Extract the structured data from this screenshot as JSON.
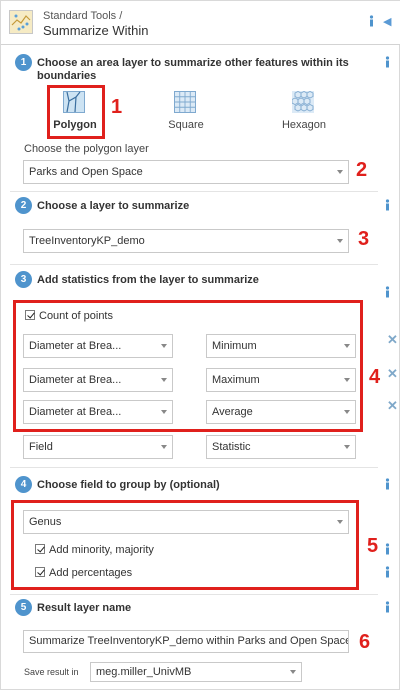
{
  "header": {
    "subtitle": "Standard Tools /",
    "title": "Summarize Within",
    "collapse_icon": "chevron-left-icon"
  },
  "step1": {
    "number": "1",
    "title_line1": "Choose an area layer to summarize other features within its",
    "title_line2": "boundaries",
    "options": [
      {
        "label": "Polygon",
        "icon": "polygon-icon",
        "selected": true
      },
      {
        "label": "Square",
        "icon": "square-grid-icon",
        "selected": false
      },
      {
        "label": "Hexagon",
        "icon": "hexagon-grid-icon",
        "selected": false
      }
    ],
    "layer_label": "Choose the polygon layer",
    "layer_value": "Parks and Open Space"
  },
  "step2": {
    "number": "2",
    "title": "Choose a layer to summarize",
    "value": "TreeInventoryKP_demo"
  },
  "step3": {
    "number": "3",
    "title": "Add statistics from the layer to summarize",
    "count_points_label": "Count of points",
    "rows": [
      {
        "field": "Diameter at Brea...",
        "statistic": "Minimum"
      },
      {
        "field": "Diameter at Brea...",
        "statistic": "Maximum"
      },
      {
        "field": "Diameter at Brea...",
        "statistic": "Average"
      },
      {
        "field": "Field",
        "statistic": "Statistic"
      }
    ]
  },
  "step4": {
    "number": "4",
    "title": "Choose field to group by (optional)",
    "value": "Genus",
    "minority_label": "Add minority, majority",
    "percentages_label": "Add percentages"
  },
  "step5": {
    "number": "5",
    "title": "Result layer name",
    "value": "Summarize TreeInventoryKP_demo within Parks and Open Space",
    "save_label": "Save result in",
    "save_value": "meg.miller_UnivMB"
  },
  "annotations": [
    "1",
    "2",
    "3",
    "4",
    "5",
    "6"
  ],
  "colors": {
    "accent": "#4f94cd",
    "annotation_red": "#e0201c"
  }
}
